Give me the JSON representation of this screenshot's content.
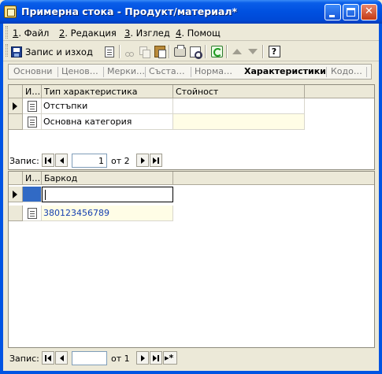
{
  "window": {
    "title": "Примерна стока - Продукт/материал*",
    "min_glyph": "",
    "max_glyph": "",
    "close_glyph": "✕"
  },
  "menu": [
    {
      "num": "1",
      "rest": ". Файл"
    },
    {
      "num": "2",
      "rest": ". Редакция"
    },
    {
      "num": "3",
      "rest": ". Изглед"
    },
    {
      "num": "4",
      "rest": ". Помощ"
    }
  ],
  "toolbar": {
    "save_label": "Запис и изход",
    "help_label": "?"
  },
  "tabs": [
    "Основни",
    "Ценов…",
    "Мерки…",
    "Съста…",
    "Норма…",
    "Характеристики",
    "Кодо…"
  ],
  "active_tab": "Характеристики",
  "characteristics_grid": {
    "headers": [
      "И…",
      "Тип характеристика",
      "Стойност"
    ],
    "rows": [
      {
        "type": "Отстъпки",
        "value": "",
        "current": true
      },
      {
        "type": "Основна категория",
        "value": "",
        "current": false
      }
    ]
  },
  "nav_top": {
    "label": "Запис:",
    "record": "1",
    "of_text": "от 2"
  },
  "barcode_grid": {
    "headers": [
      "И…",
      "Баркод"
    ],
    "new_row_value": "",
    "rows": [
      {
        "barcode": "380123456789"
      }
    ]
  },
  "nav_bottom": {
    "label": "Запис:",
    "record": "",
    "of_text": "от 1",
    "new_glyph": "▸*"
  },
  "colors": {
    "titlebar": "#0054e3",
    "face": "#ece9d8",
    "selection": "#316ac5",
    "link": "#1640b0",
    "edit_row": "#fffde6"
  }
}
